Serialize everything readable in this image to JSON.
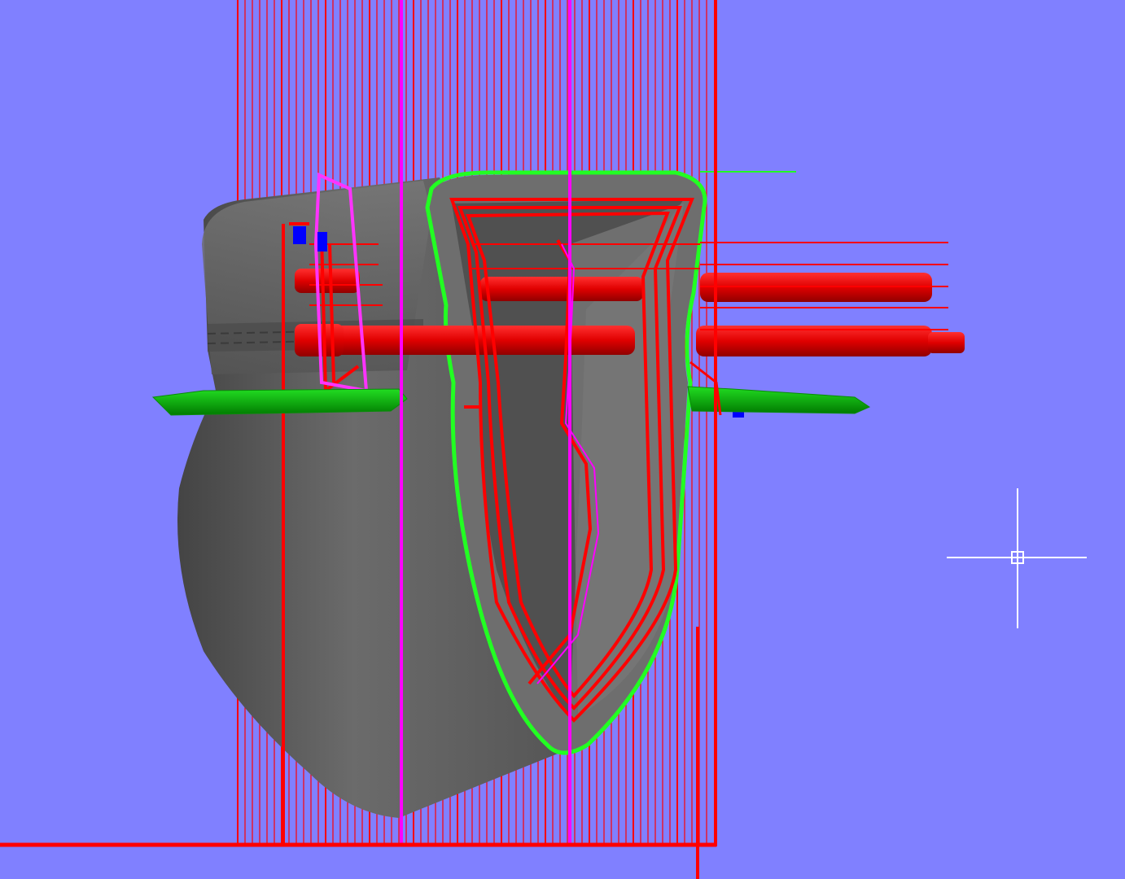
{
  "viewport": {
    "background": "#8080ff",
    "cursor": {
      "icon": "crosshair-icon",
      "color": "#ffffff"
    }
  },
  "scene": {
    "hull_color": "#5a5a5a",
    "fin_color": "#00c000",
    "outline_color": "#22ff22",
    "construction_line_color": "#ff0000",
    "axis_line_color": "#ff00ff",
    "marker_color": "#0000ff"
  }
}
